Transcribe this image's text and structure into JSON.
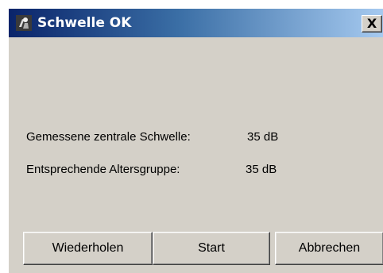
{
  "window": {
    "title": "Schwelle OK",
    "close_label": "X",
    "icon": "speaker-person-icon"
  },
  "results": {
    "threshold_label": "Gemessene zentrale Schwelle:",
    "threshold_value": "35 dB",
    "age_group_label": "Entsprechende Altersgruppe:",
    "age_group_value": "35 dB"
  },
  "buttons": {
    "repeat": "Wiederholen",
    "start": "Start",
    "cancel": "Abbrechen"
  },
  "colors": {
    "window_bg": "#d4d0c8",
    "titlebar_start": "#0a246a",
    "titlebar_end": "#a6caf0"
  }
}
